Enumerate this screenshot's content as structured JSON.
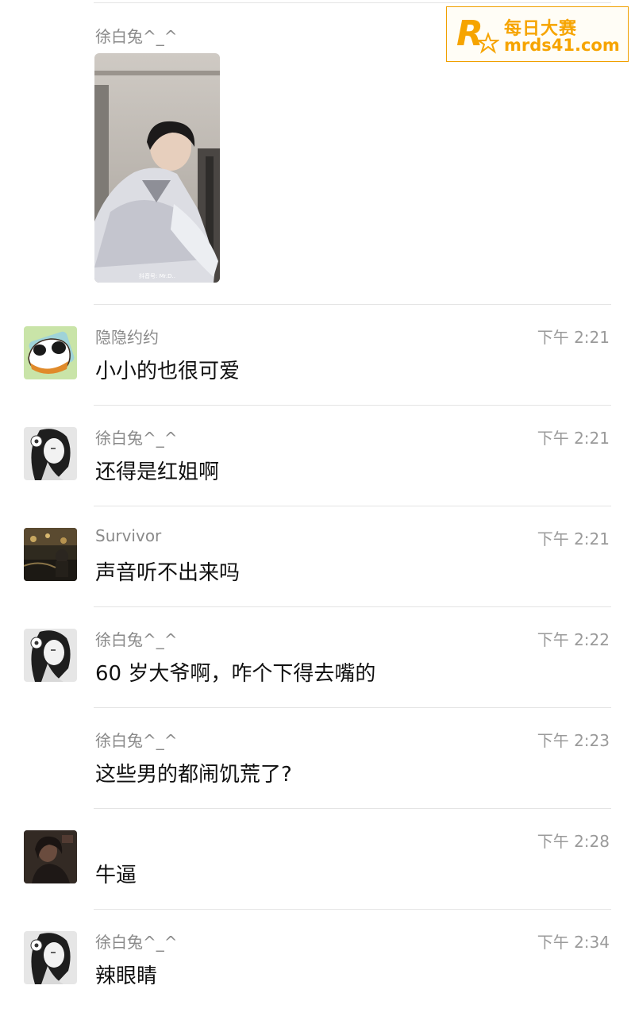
{
  "watermark": {
    "line1": "每日大赛",
    "line2": "mrds41.com",
    "logo_letter": "R",
    "color": "#f6a400"
  },
  "first_message": {
    "sender": "徐白兔^_^",
    "photo_caption": "抖音号: Mr.D.."
  },
  "messages": [
    {
      "sender": "隐隐约约",
      "time": "下午 2:21",
      "text": "小小的也很可爱",
      "avatar": "panda-toast-avatar"
    },
    {
      "sender": "徐白兔^_^",
      "time": "下午 2:21",
      "text": "还得是红姐啊",
      "avatar": "lady-sketch-avatar"
    },
    {
      "sender": "Survivor",
      "time": "下午 2:21",
      "text": "声音听不出来吗",
      "avatar": "dark-crowd-avatar"
    },
    {
      "sender": "徐白兔^_^",
      "time": "下午 2:22",
      "text": "60 岁大爷啊，咋个下得去嘴的",
      "avatar": "lady-sketch-avatar"
    },
    {
      "sender": "徐白兔^_^",
      "time": "下午 2:23",
      "text": "这些男的都闹饥荒了?",
      "avatar": ""
    },
    {
      "sender": "",
      "time": "下午 2:28",
      "text": "牛逼",
      "avatar": "dark-portrait-avatar"
    },
    {
      "sender": "徐白兔^_^",
      "time": "下午 2:34",
      "text": "辣眼睛",
      "avatar": "lady-sketch-avatar"
    }
  ]
}
